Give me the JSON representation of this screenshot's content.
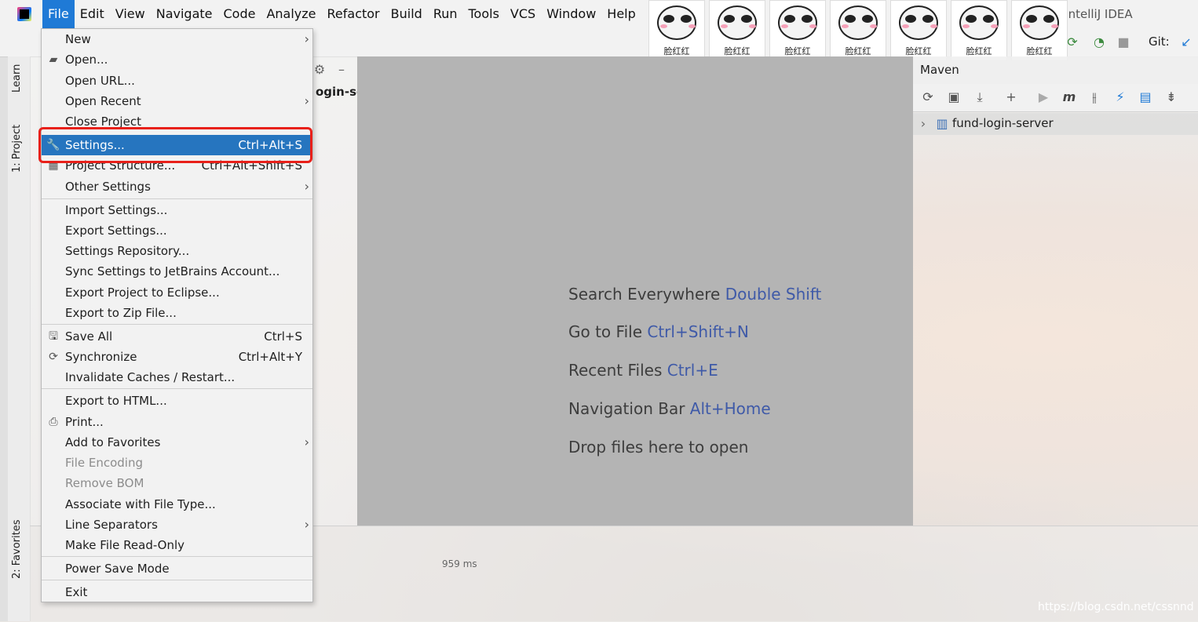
{
  "window": {
    "title": "- IntelliJ IDEA"
  },
  "menubar": {
    "items": [
      "File",
      "Edit",
      "View",
      "Navigate",
      "Code",
      "Analyze",
      "Refactor",
      "Build",
      "Run",
      "Tools",
      "VCS",
      "Window",
      "Help"
    ],
    "active": "File"
  },
  "stickers": {
    "caption": "脸红红",
    "count": 7
  },
  "toolbar": {
    "git_label": "Git:"
  },
  "left_strip": {
    "tabs": [
      "Learn",
      "1: Project",
      "2: Favorites"
    ]
  },
  "project_panel": {
    "tab_label": "ogin-se"
  },
  "file_menu": {
    "items": [
      {
        "label": "New",
        "shortcut": "",
        "submenu": true,
        "icon": ""
      },
      {
        "label": "Open...",
        "shortcut": "",
        "submenu": false,
        "icon": "folder-icon"
      },
      {
        "label": "Open URL...",
        "shortcut": "",
        "submenu": false,
        "icon": ""
      },
      {
        "label": "Open Recent",
        "shortcut": "",
        "submenu": true,
        "icon": ""
      },
      {
        "label": "Close Project",
        "shortcut": "",
        "submenu": false,
        "icon": ""
      },
      {
        "label": "Settings...",
        "shortcut": "Ctrl+Alt+S",
        "submenu": false,
        "icon": "wrench-icon",
        "selected": true
      },
      {
        "label": "Project Structure...",
        "shortcut": "Ctrl+Alt+Shift+S",
        "submenu": false,
        "icon": "project-structure-icon"
      },
      {
        "label": "Other Settings",
        "shortcut": "",
        "submenu": true,
        "icon": ""
      },
      {
        "label": "Import Settings...",
        "shortcut": "",
        "submenu": false,
        "icon": ""
      },
      {
        "label": "Export Settings...",
        "shortcut": "",
        "submenu": false,
        "icon": ""
      },
      {
        "label": "Settings Repository...",
        "shortcut": "",
        "submenu": false,
        "icon": ""
      },
      {
        "label": "Sync Settings to JetBrains Account...",
        "shortcut": "",
        "submenu": false,
        "icon": ""
      },
      {
        "label": "Export Project to Eclipse...",
        "shortcut": "",
        "submenu": false,
        "icon": ""
      },
      {
        "label": "Export to Zip File...",
        "shortcut": "",
        "submenu": false,
        "icon": ""
      },
      {
        "label": "Save All",
        "shortcut": "Ctrl+S",
        "submenu": false,
        "icon": "save-icon"
      },
      {
        "label": "Synchronize",
        "shortcut": "Ctrl+Alt+Y",
        "submenu": false,
        "icon": "sync-icon"
      },
      {
        "label": "Invalidate Caches / Restart...",
        "shortcut": "",
        "submenu": false,
        "icon": ""
      },
      {
        "label": "Export to HTML...",
        "shortcut": "",
        "submenu": false,
        "icon": ""
      },
      {
        "label": "Print...",
        "shortcut": "",
        "submenu": false,
        "icon": "printer-icon"
      },
      {
        "label": "Add to Favorites",
        "shortcut": "",
        "submenu": true,
        "icon": ""
      },
      {
        "label": "File Encoding",
        "shortcut": "",
        "submenu": false,
        "icon": "",
        "disabled": true
      },
      {
        "label": "Remove BOM",
        "shortcut": "",
        "submenu": false,
        "icon": "",
        "disabled": true
      },
      {
        "label": "Associate with File Type...",
        "shortcut": "",
        "submenu": false,
        "icon": ""
      },
      {
        "label": "Line Separators",
        "shortcut": "",
        "submenu": true,
        "icon": ""
      },
      {
        "label": "Make File Read-Only",
        "shortcut": "",
        "submenu": false,
        "icon": ""
      },
      {
        "label": "Power Save Mode",
        "shortcut": "",
        "submenu": false,
        "icon": ""
      },
      {
        "label": "Exit",
        "shortcut": "",
        "submenu": false,
        "icon": ""
      }
    ]
  },
  "editor": {
    "hints": [
      {
        "text": "Search Everywhere",
        "key": "Double Shift"
      },
      {
        "text": "Go to File",
        "key": "Ctrl+Shift+N"
      },
      {
        "text": "Recent Files",
        "key": "Ctrl+E"
      },
      {
        "text": "Navigation Bar",
        "key": "Alt+Home"
      },
      {
        "text": "Drop files here to open",
        "key": ""
      }
    ]
  },
  "maven": {
    "title": "Maven",
    "project": "fund-login-server"
  },
  "bottom": {
    "timing": "959 ms"
  },
  "watermark": "https://blog.csdn.net/cssnnd",
  "colors": {
    "accent": "#2675bf",
    "highlight_border": "#e8201a",
    "hint_key": "#3f5aa8"
  }
}
